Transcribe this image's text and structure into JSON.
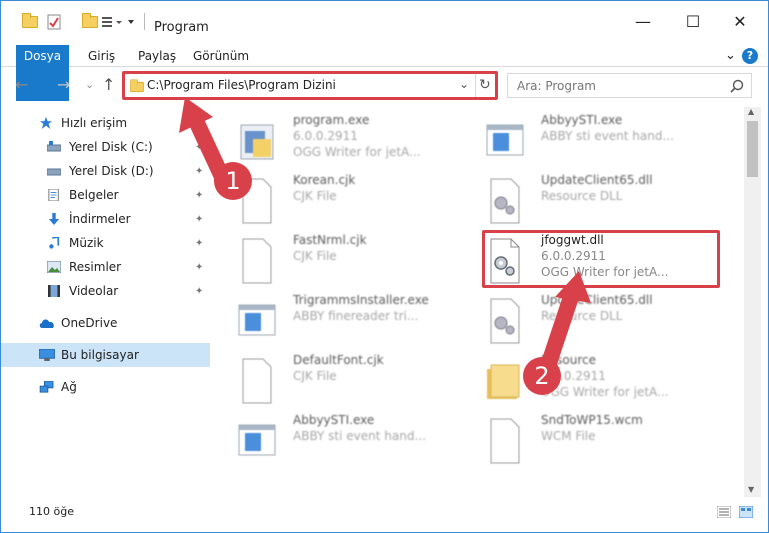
{
  "window": {
    "title": "Program",
    "controls": {
      "minimize": "—",
      "maximize": "☐",
      "close": "✕"
    }
  },
  "ribbon": {
    "tabs": [
      "Dosya",
      "Giriş",
      "Paylaş",
      "Görünüm"
    ],
    "expand": "⌄",
    "help": "?"
  },
  "address": {
    "path": "C:\\Program Files\\Program Dizini",
    "dropdown": "⌄",
    "refresh": "↻"
  },
  "search": {
    "placeholder": "Ara: Program",
    "icon": "search-icon"
  },
  "nav": {
    "back": "←",
    "forward": "→",
    "recent": "⌄",
    "up": "↑"
  },
  "sidebar": {
    "quick_access": "Hızlı erişim",
    "items": [
      {
        "label": "Yerel Disk (C:)",
        "icon": "drive-icon"
      },
      {
        "label": "Yerel Disk (D:)",
        "icon": "drive-icon"
      },
      {
        "label": "Belgeler",
        "icon": "documents-icon"
      },
      {
        "label": "İndirmeler",
        "icon": "downloads-icon"
      },
      {
        "label": "Müzik",
        "icon": "music-icon"
      },
      {
        "label": "Resimler",
        "icon": "pictures-icon"
      },
      {
        "label": "Videolar",
        "icon": "videos-icon"
      }
    ],
    "pin": "📌",
    "onedrive": "OneDrive",
    "this_pc": "Bu bilgisayar",
    "network": "Ağ"
  },
  "files": [
    {
      "name": "program.exe",
      "line2": "6.0.0.2911",
      "line3": "OGG Writer for jetA...",
      "type": "exe"
    },
    {
      "name": "AbbyySTI.exe",
      "line2": "ABBY sti event hand...",
      "line3": "",
      "type": "app"
    },
    {
      "name": "Korean.cjk",
      "line2": "CJK File",
      "line3": "",
      "type": "doc"
    },
    {
      "name": "UpdateClient65.dll",
      "line2": "Resource DLL",
      "line3": "",
      "type": "dll"
    },
    {
      "name": "FastNrml.cjk",
      "line2": "CJK File",
      "line3": "",
      "type": "doc"
    },
    {
      "name": "jfoggwt.dll",
      "line2": "6.0.0.2911",
      "line3": "OGG Writer for jetA...",
      "type": "dll"
    },
    {
      "name": "TrigrammsInstaller.exe",
      "line2": "ABBY finereader tri...",
      "line3": "",
      "type": "app"
    },
    {
      "name": "UpdateClient65.dll",
      "line2": "Resource DLL",
      "line3": "",
      "type": "dll"
    },
    {
      "name": "DefaultFont.cjk",
      "line2": "CJK File",
      "line3": "",
      "type": "doc"
    },
    {
      "name": "Resource",
      "line2": "6.0.0.2911",
      "line3": "OGG Writer for jetA...",
      "type": "folder"
    },
    {
      "name": "AbbyySTI.exe",
      "line2": "ABBY sti event hand...",
      "line3": "",
      "type": "app"
    },
    {
      "name": "SndToWP15.wcm",
      "line2": "WCM File",
      "line3": "",
      "type": "doc"
    }
  ],
  "status": {
    "count": "110 öğe"
  },
  "annotations": {
    "step1": "1",
    "step2": "2"
  },
  "colors": {
    "accent": "#1979ca",
    "highlight": "#d9414a",
    "selected": "#cce4f7"
  }
}
